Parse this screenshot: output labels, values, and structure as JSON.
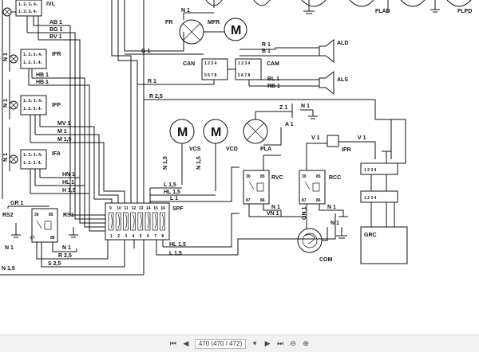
{
  "labels": {
    "ivl": "IVL",
    "ifr": "IFR",
    "ifp": "IFP",
    "ifa": "IFA",
    "n1": "N 1",
    "ab1": "AB 1",
    "bg1": "BG 1",
    "bv1": "BV 1",
    "hb1a": "HB 1",
    "hb1b": "HB 1",
    "mv1": "MV 1",
    "m1": "M 1",
    "m15": "M 1,5",
    "hn1": "HN 1",
    "hl1": "HL 1",
    "h15": "H 1,5",
    "fr": "FR",
    "mfr": "MFR",
    "m": "M",
    "flad": "FLAD",
    "flpd": "FLPD",
    "g1": "G 1",
    "r1": "R 1",
    "b1": "B 1",
    "can": "CAN",
    "cam": "CAM",
    "ald": "ALD",
    "als": "ALS",
    "bl1": "BL 1",
    "rb1": "RB 1",
    "r25": "R 2,5",
    "z1": "Z 1",
    "a1": "A 1",
    "v1": "V 1",
    "ipr": "IPR",
    "vcs": "VCS",
    "vcd": "VCD",
    "pla": "PLA",
    "n15": "N 1,5",
    "l15": "L 1,5",
    "hl15": "HL 1,5",
    "l1": "L 1",
    "spf": "SPF",
    "rvc": "RVC",
    "rcc": "RCC",
    "vn1": "VN 1",
    "gn1": "GN 1",
    "com": "COM",
    "grc": "GRC",
    "gr1": "GR 1",
    "rs2": "RS2",
    "rs1": "RS1",
    "s25": "S 2,5",
    "r25b": "R 2,5",
    "p30": "30",
    "p85": "85",
    "p87": "87",
    "p86": "86",
    "n3": "3",
    "n4": "4",
    "n5": "5",
    "n6": "6",
    "n7": "7",
    "n8": "8",
    "t1": "1",
    "t2": "2",
    "t3": "3",
    "t4": "4"
  },
  "terminals_top": [
    "1",
    "2",
    "3",
    "4"
  ],
  "spf_top": [
    "9",
    "10",
    "11",
    "12",
    "13",
    "14",
    "15",
    "16"
  ],
  "spf_bottom": [
    "1",
    "2",
    "3",
    "4",
    "5",
    "6",
    "7",
    "8"
  ],
  "toolbar": {
    "first": "⏮",
    "prev": "◀",
    "page": "470 (470 / 472)",
    "menu": "▾",
    "next": "▶",
    "last": "⏭",
    "zoom_out": "⊖",
    "zoom_in": "⊕"
  }
}
